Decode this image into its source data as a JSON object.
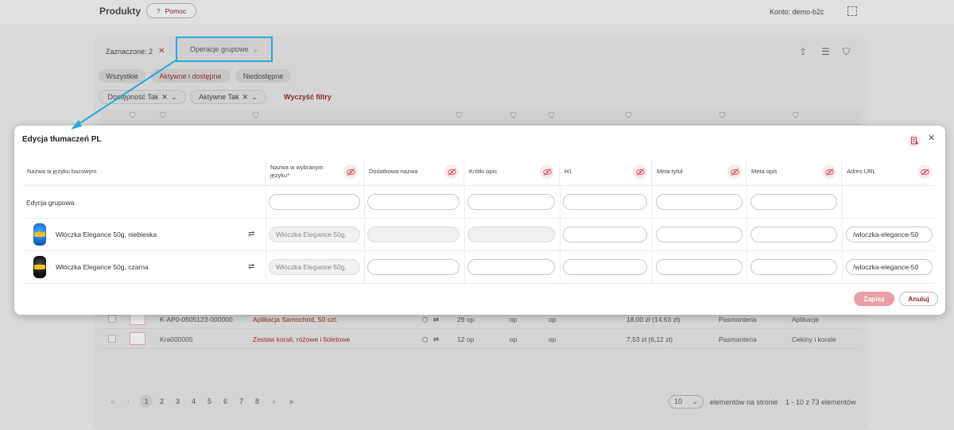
{
  "app": {
    "title": "Produkty",
    "help_label": "Pomoc",
    "help_glyph": "?",
    "account": "Konto: demo-b2c"
  },
  "toolbar": {
    "selected": "Zaznaczone: 2",
    "group_ops": "Operacje grupowe"
  },
  "filters": {
    "pills": [
      "Wszystkie",
      "Aktywne i dostępne",
      "Niedostępne"
    ],
    "chips": [
      "Dostępność Tak",
      "Aktywne Tak"
    ],
    "clear": "Wyczyść filtry"
  },
  "products": [
    {
      "sku": "K-AP0-0505123-000000",
      "name": "Aplikacja Samochód, 50 szt.",
      "stock": "29 op",
      "unit1": "op",
      "unit2": "op",
      "price": "18,00 zł (14,63 zł)",
      "cat": "Pasmanteria",
      "sub": "Aplikacje"
    },
    {
      "sku": "Kra000005",
      "name": "Zestaw korali, różowe i fioletowe",
      "stock": "12 op",
      "unit1": "op",
      "unit2": "op",
      "price": "7,53 zł (6,12 zł)",
      "cat": "Pasmanteria",
      "sub": "Cekiny i korale"
    }
  ],
  "pagination": {
    "pages": [
      "1",
      "2",
      "3",
      "4",
      "5",
      "6",
      "7",
      "8"
    ],
    "per_page": "10",
    "per_label": "elementów na stronie",
    "range": "1 - 10 z 73 elementów"
  },
  "modal": {
    "title": "Edycja tłumaczeń PL",
    "columns": {
      "base": "Nazwa w języku bazowym",
      "name_l1": "Nazwa w wybranym",
      "name_l2": "języku*",
      "extra": "Dodatkowa nazwa",
      "short": "Krótki opis",
      "h1": "H1",
      "meta_title": "Meta tytuł",
      "meta_desc": "Meta opis",
      "url": "Adres URL"
    },
    "group_edit": "Edycja grupowa",
    "rows": [
      {
        "base": "Włóczka Elegance 50g, niebieska",
        "name_value": "Włóczka Elegance 50g,",
        "url_value": "/wloczka-elegance-50"
      },
      {
        "base": "Włóczka Elegance 50g, czarna",
        "name_value": "Włóczka Elegance 50g,",
        "url_value": "/wloczka-elegance-50"
      }
    ],
    "save": "Zapisz",
    "cancel": "Anuluj"
  },
  "colors": {
    "accent": "#2aa7e0",
    "brand_red": "#8a2a2a",
    "save_bg": "#e8a0a4"
  }
}
